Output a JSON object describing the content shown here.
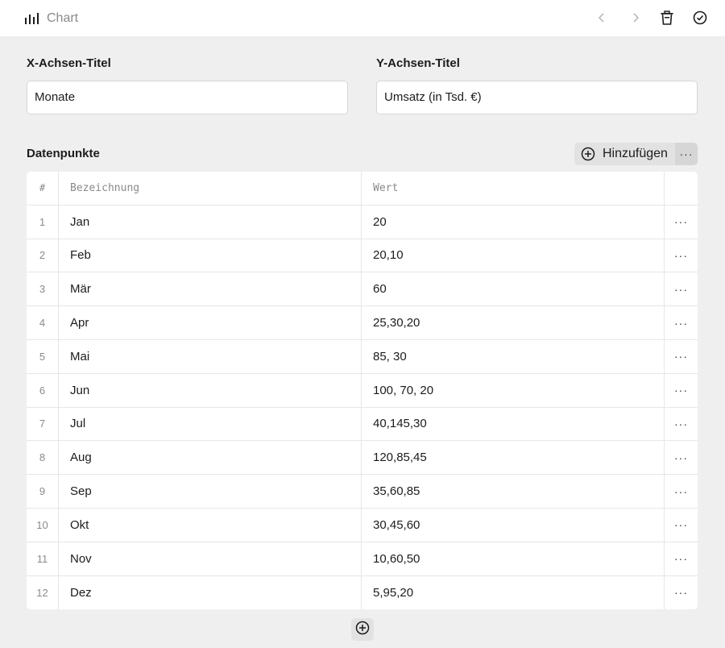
{
  "header": {
    "title": "Chart",
    "icon": "bar-chart-icon",
    "actions": [
      "chevron-left-icon",
      "chevron-right-icon",
      "trash-icon",
      "check-circle-icon"
    ]
  },
  "fields": {
    "x_axis": {
      "label": "X-Achsen-Titel",
      "value": "Monate"
    },
    "y_axis": {
      "label": "Y-Achsen-Titel",
      "value": "Umsatz (in Tsd. €)"
    }
  },
  "datapoints": {
    "title": "Datenpunkte",
    "add_label": "Hinzufügen",
    "more_label": "···",
    "columns": {
      "num": "#",
      "label": "Bezeichnung",
      "value": "Wert"
    },
    "rows": [
      {
        "num": "1",
        "label": "Jan",
        "value": "20"
      },
      {
        "num": "2",
        "label": "Feb",
        "value": "20,10"
      },
      {
        "num": "3",
        "label": "Mär",
        "value": "60"
      },
      {
        "num": "4",
        "label": "Apr",
        "value": "25,30,20"
      },
      {
        "num": "5",
        "label": "Mai",
        "value": "85, 30"
      },
      {
        "num": "6",
        "label": "Jun",
        "value": "100, 70, 20"
      },
      {
        "num": "7",
        "label": "Jul",
        "value": "40,145,30"
      },
      {
        "num": "8",
        "label": "Aug",
        "value": "120,85,45"
      },
      {
        "num": "9",
        "label": "Sep",
        "value": "35,60,85"
      },
      {
        "num": "10",
        "label": "Okt",
        "value": "30,45,60"
      },
      {
        "num": "11",
        "label": "Nov",
        "value": "10,60,50"
      },
      {
        "num": "12",
        "label": "Dez",
        "value": "5,95,20"
      }
    ],
    "row_action": "···"
  },
  "colors": {
    "background": "#efefef",
    "panel": "#ffffff",
    "muted": "#8a8a8a",
    "button": "#e2e2e2"
  }
}
